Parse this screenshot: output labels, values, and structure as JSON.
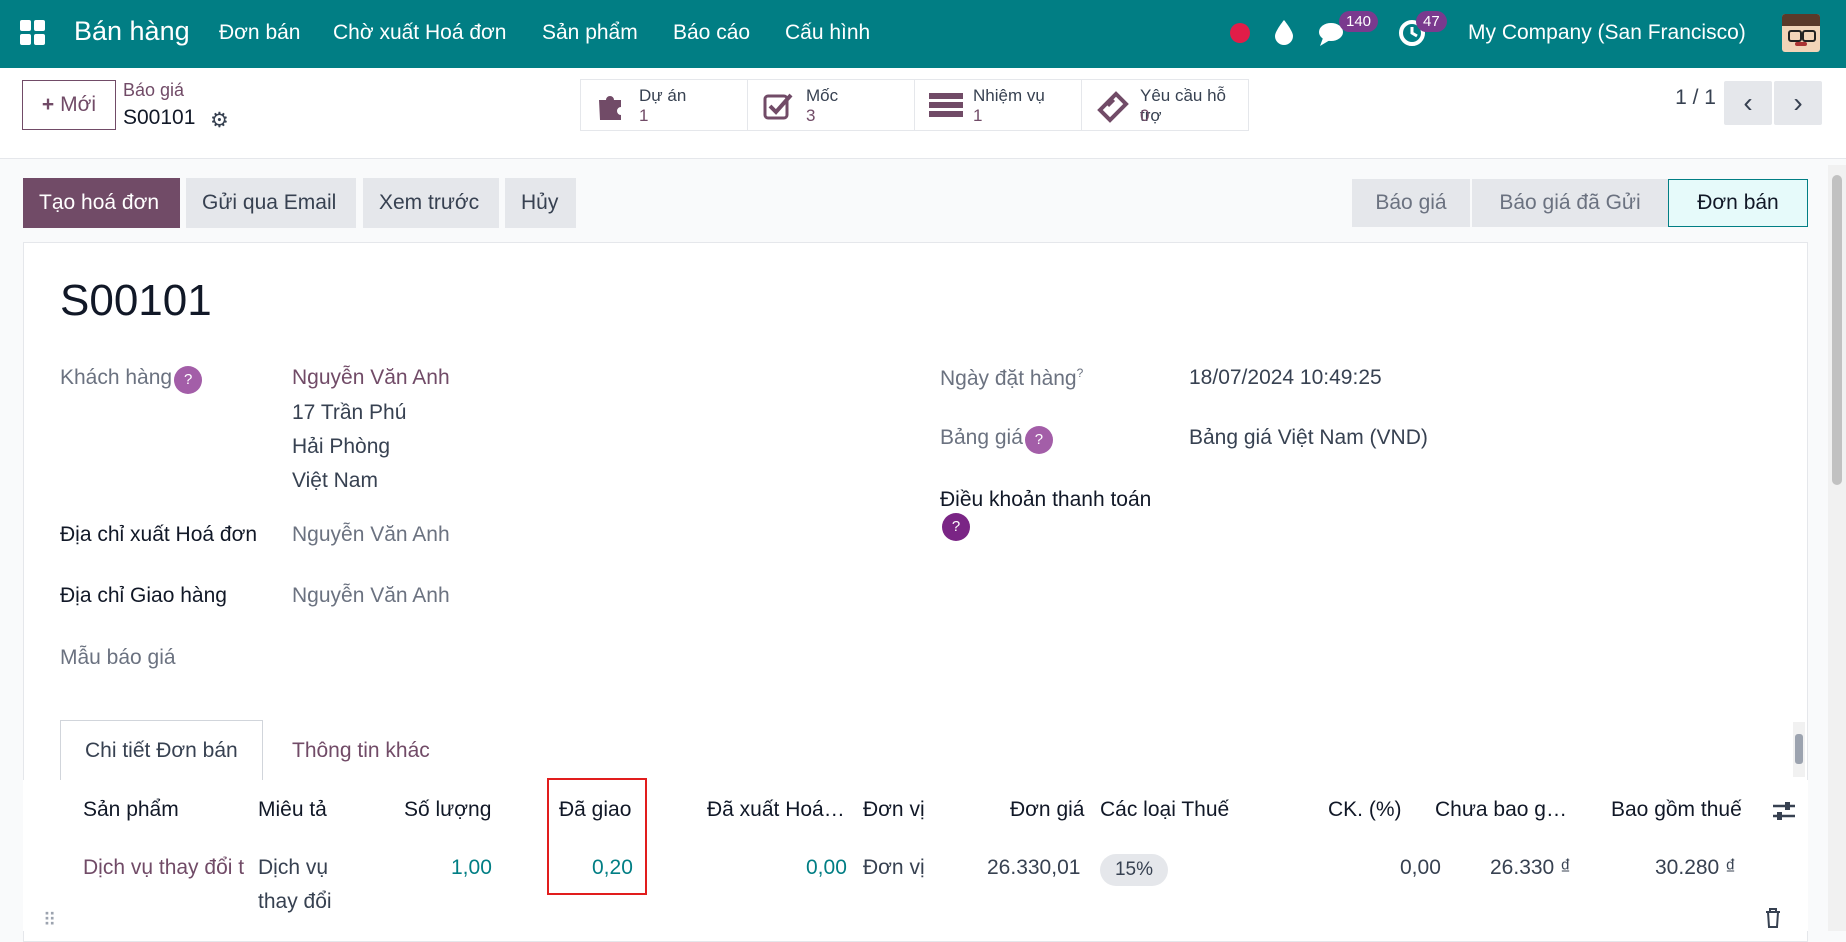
{
  "topbar": {
    "brand": "Bán hàng",
    "menu": [
      "Đơn bán",
      "Chờ xuất Hoá đơn",
      "Sản phẩm",
      "Báo cáo",
      "Cấu hình"
    ],
    "messages_count": "140",
    "activities_count": "47",
    "company": "My Company (San Francisco)"
  },
  "control": {
    "new_label": "Mới",
    "breadcrumb_parent": "Báo giá",
    "breadcrumb_current": "S00101",
    "smart_buttons": [
      {
        "label": "Dự án",
        "value": "1",
        "icon": "puzzle-icon"
      },
      {
        "label": "Mốc",
        "value": "3",
        "icon": "check-square-icon"
      },
      {
        "label": "Nhiệm vụ",
        "value": "1",
        "icon": "tasks-icon"
      },
      {
        "label": "Yêu cầu hỗ trợ",
        "value": "0",
        "icon": "ticket-icon"
      }
    ],
    "pager": "1 / 1"
  },
  "actions": {
    "create_invoice": "Tạo hoá đơn",
    "send_email": "Gửi qua Email",
    "preview": "Xem trước",
    "cancel": "Hủy"
  },
  "statusbar": [
    "Báo giá",
    "Báo giá đã Gửi",
    "Đơn bán"
  ],
  "form": {
    "title": "S00101",
    "customer_label": "Khách hàng",
    "customer_name": "Nguyễn Văn Anh",
    "customer_address": [
      "17 Trần Phú",
      "Hải Phòng",
      "Việt Nam"
    ],
    "invoice_address_label": "Địa chỉ xuất Hoá đơn",
    "invoice_address": "Nguyễn Văn Anh",
    "delivery_address_label": "Địa chỉ Giao hàng",
    "delivery_address": "Nguyễn Văn Anh",
    "quote_template_label": "Mẫu báo giá",
    "order_date_label": "Ngày đặt hàng",
    "order_date": "18/07/2024 10:49:25",
    "pricelist_label": "Bảng giá",
    "pricelist": "Bảng giá Việt Nam (VND)",
    "payment_terms_label": "Điều khoản thanh toán"
  },
  "tabs": [
    "Chi tiết Đơn bán",
    "Thông tin khác"
  ],
  "table": {
    "columns": [
      "Sản phẩm",
      "Miêu tả",
      "Số lượng",
      "Đã giao",
      "Đã xuất Hoá…",
      "Đơn vị",
      "Đơn giá",
      "Các loại Thuế",
      "CK. (%)",
      "Chưa bao g…",
      "Bao gồm thuế"
    ],
    "rows": [
      {
        "product": "Dịch vụ thay đổi t",
        "description_1": "Dịch vụ",
        "description_2": "thay đổi",
        "quantity": "1,00",
        "delivered": "0,20",
        "invoiced": "0,00",
        "uom": "Đơn vị",
        "unit_price": "26.330,01",
        "tax": "15%",
        "discount": "0,00",
        "subtotal": "26.330 ₫",
        "total": "30.280 ₫"
      }
    ]
  }
}
